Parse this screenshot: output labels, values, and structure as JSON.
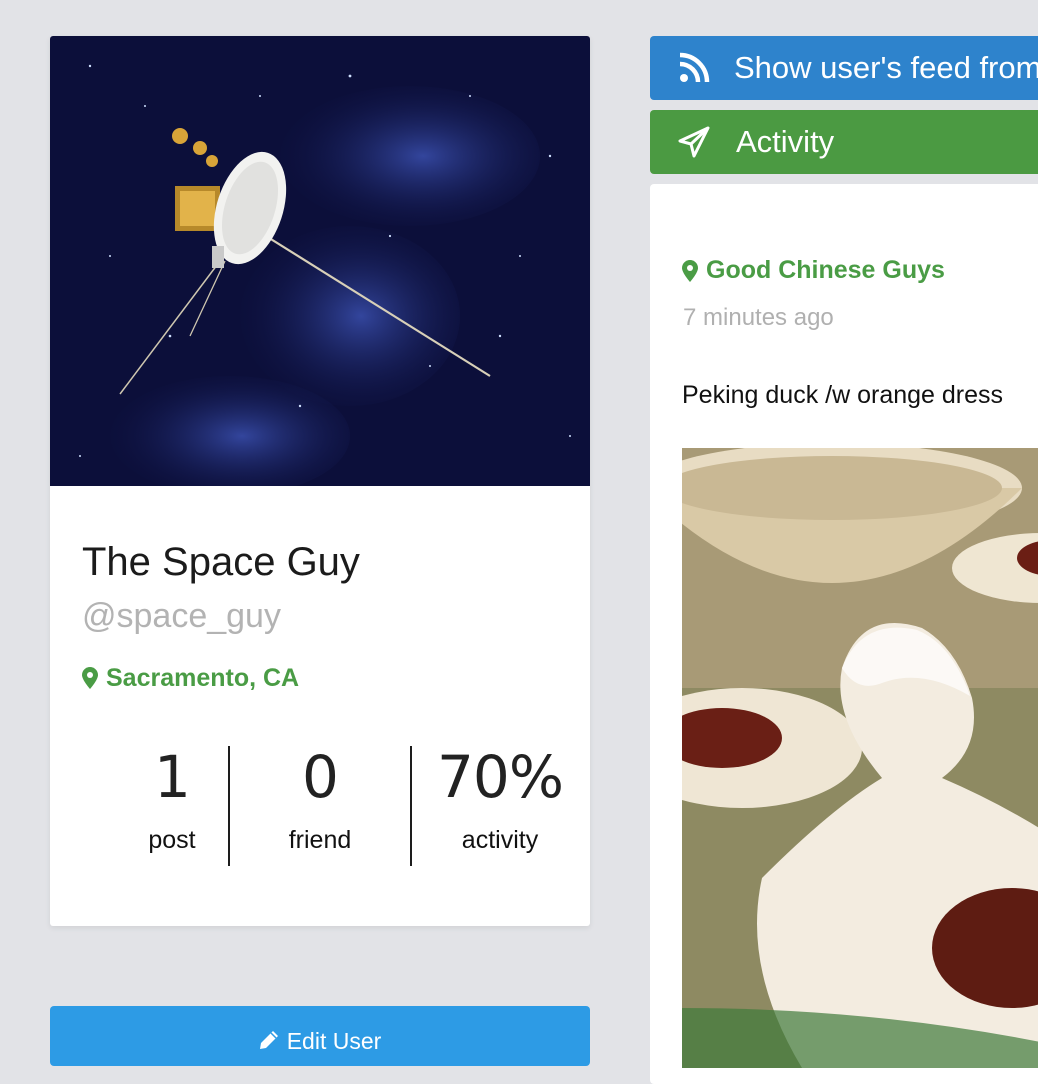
{
  "profile": {
    "display_name": "The Space Guy",
    "username": "@space_guy",
    "location": "Sacramento, CA",
    "image_subject": "spacecraft-in-starfield",
    "stats": [
      {
        "value": "1",
        "label": "post"
      },
      {
        "value": "0",
        "label": "friend"
      },
      {
        "value": "70%",
        "label": "activity"
      }
    ],
    "edit_label": "Edit User"
  },
  "feed": {
    "feed_button_label": "Show user's feed from",
    "activity_label": "Activity"
  },
  "post": {
    "place": "Good Chinese Guys",
    "time": "7 minutes ago",
    "text": "Peking duck /w orange dress",
    "image_subject": "peking-duck-dish"
  },
  "colors": {
    "background": "#e2e3e7",
    "green_accent": "#4a9c45",
    "feed_button": "#2e83cc",
    "activity_tab": "#4b9a42",
    "edit_button": "#2d9be5",
    "muted_text": "#b3b3b3"
  }
}
